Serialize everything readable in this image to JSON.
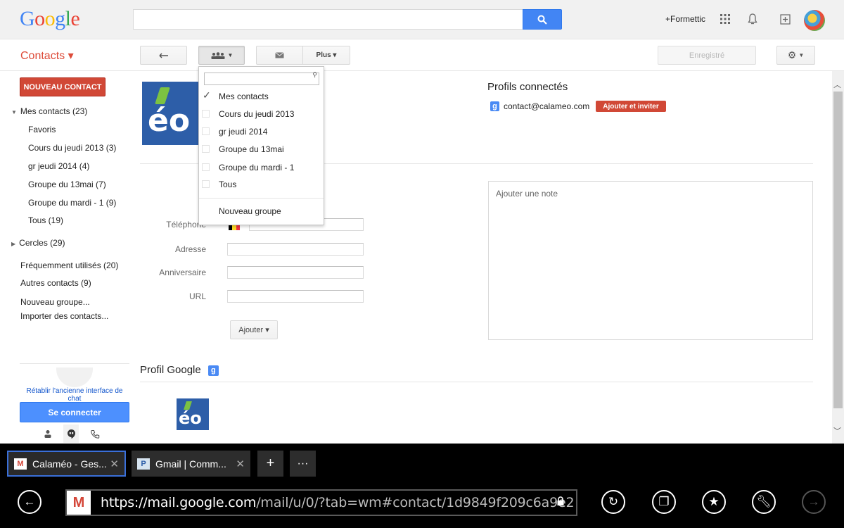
{
  "header": {
    "logo_text": "Google",
    "user_link": "+Formettic"
  },
  "subheader": {
    "app_title": "Contacts ▾",
    "more_label": "Plus ▾",
    "saved_label": "Enregistré"
  },
  "sidebar": {
    "new_contact_label": "NOUVEAU CONTACT",
    "my_contacts": "Mes contacts (23)",
    "groups": [
      "Favoris",
      "Cours du jeudi 2013 (3)",
      "gr jeudi 2014 (4)",
      "Groupe du 13mai (7)",
      "Groupe du mardi - 1 (9)",
      "Tous (19)"
    ],
    "circles": "Cercles (29)",
    "frequent": "Fréquemment utilisés (20)",
    "others": "Autres contacts (9)",
    "new_group": "Nouveau groupe...",
    "import": "Importer des contacts..."
  },
  "dropdown": {
    "items": [
      {
        "label": "Mes contacts",
        "checked": true
      },
      {
        "label": "Cours du jeudi 2013",
        "checked": false
      },
      {
        "label": "gr jeudi 2014",
        "checked": false
      },
      {
        "label": "Groupe du 13mai",
        "checked": false
      },
      {
        "label": "Groupe du mardi - 1",
        "checked": false
      },
      {
        "label": "Tous",
        "checked": false
      }
    ],
    "new_group": "Nouveau groupe"
  },
  "form": {
    "phone_label": "Téléphone",
    "address_label": "Adresse",
    "birthday_label": "Anniversaire",
    "url_label": "URL",
    "add_button": "Ajouter ▾"
  },
  "profile": {
    "google_profile_title": "Profil Google",
    "photo_text": "éo",
    "connected_title": "Profils connectés",
    "email": "contact@calameo.com",
    "invite_button": "Ajouter et inviter",
    "note_placeholder": "Ajouter une note"
  },
  "chat": {
    "restore_link": "Rétablir l'ancienne interface de chat",
    "connect_button": "Se connecter"
  },
  "browser": {
    "tabs": [
      {
        "title": "Calaméo - Ges...",
        "active": true
      },
      {
        "title": "Gmail | Comm...",
        "active": false
      }
    ],
    "url_host": "https://mail.google.com",
    "url_path": "/mail/u/0/?tab=wm#contact/1d9849f209c6a9e2"
  },
  "colors": {
    "google_red": "#dd4b39",
    "action_red": "#d14836",
    "search_blue": "#4285f4",
    "connect_blue": "#4d90fe"
  }
}
